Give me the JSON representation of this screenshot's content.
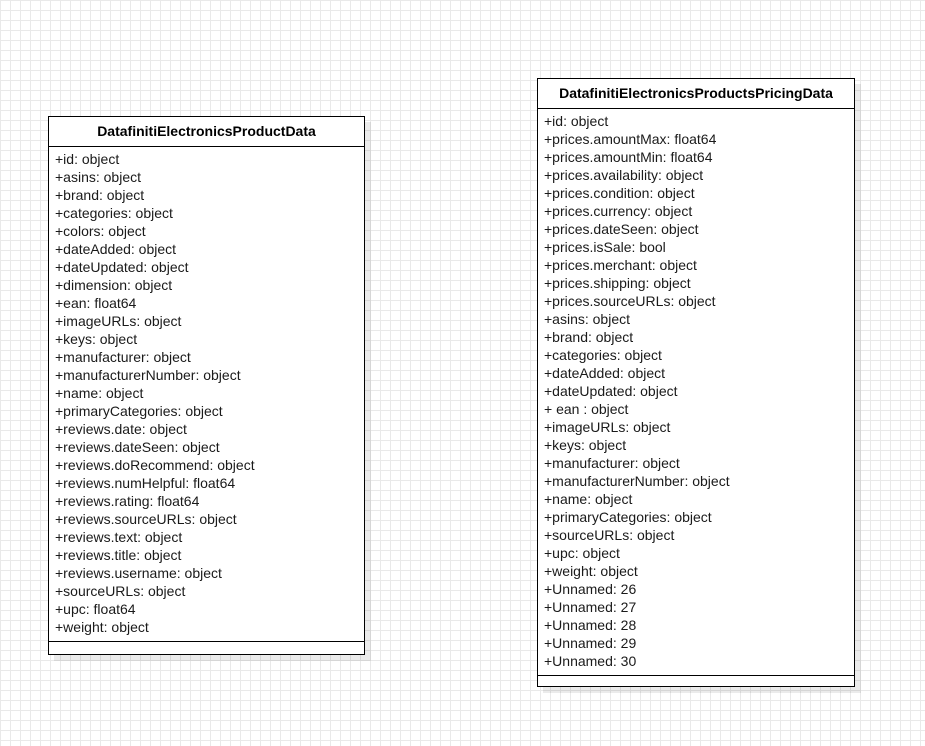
{
  "diagram": {
    "classes": [
      {
        "name": "DatafinitiElectronicsProductData",
        "attributes": [
          "+id: object",
          "+asins: object",
          "+brand: object",
          "+categories: object",
          "+colors: object",
          "+dateAdded: object",
          "+dateUpdated: object",
          "+dimension: object",
          "+ean: float64",
          "+imageURLs: object",
          "+keys: object",
          "+manufacturer: object",
          "+manufacturerNumber: object",
          "+name: object",
          "+primaryCategories: object",
          "+reviews.date: object",
          "+reviews.dateSeen: object",
          "+reviews.doRecommend: object",
          "+reviews.numHelpful: float64",
          "+reviews.rating: float64",
          "+reviews.sourceURLs: object",
          "+reviews.text: object",
          "+reviews.title: object",
          "+reviews.username: object",
          "+sourceURLs: object",
          "+upc: float64",
          "+weight: object"
        ]
      },
      {
        "name": "DatafinitiElectronicsProductsPricingData",
        "attributes": [
          "+id: object",
          "+prices.amountMax: float64",
          "+prices.amountMin: float64",
          "+prices.availability: object",
          "+prices.condition: object",
          "+prices.currency: object",
          "+prices.dateSeen: object",
          "+prices.isSale: bool",
          "+prices.merchant: object",
          "+prices.shipping: object",
          "+prices.sourceURLs: object",
          "+asins: object",
          "+brand: object",
          "+categories: object",
          "+dateAdded: object",
          "+dateUpdated: object",
          "+ ean : object",
          "+imageURLs: object",
          "+keys: object",
          "+manufacturer: object",
          "+manufacturerNumber: object",
          "+name: object",
          "+primaryCategories: object",
          "+sourceURLs: object",
          "+upc: object",
          "+weight: object",
          "+Unnamed: 26",
          "+Unnamed: 27",
          "+Unnamed: 28",
          "+Unnamed: 29",
          "+Unnamed: 30"
        ]
      }
    ]
  }
}
